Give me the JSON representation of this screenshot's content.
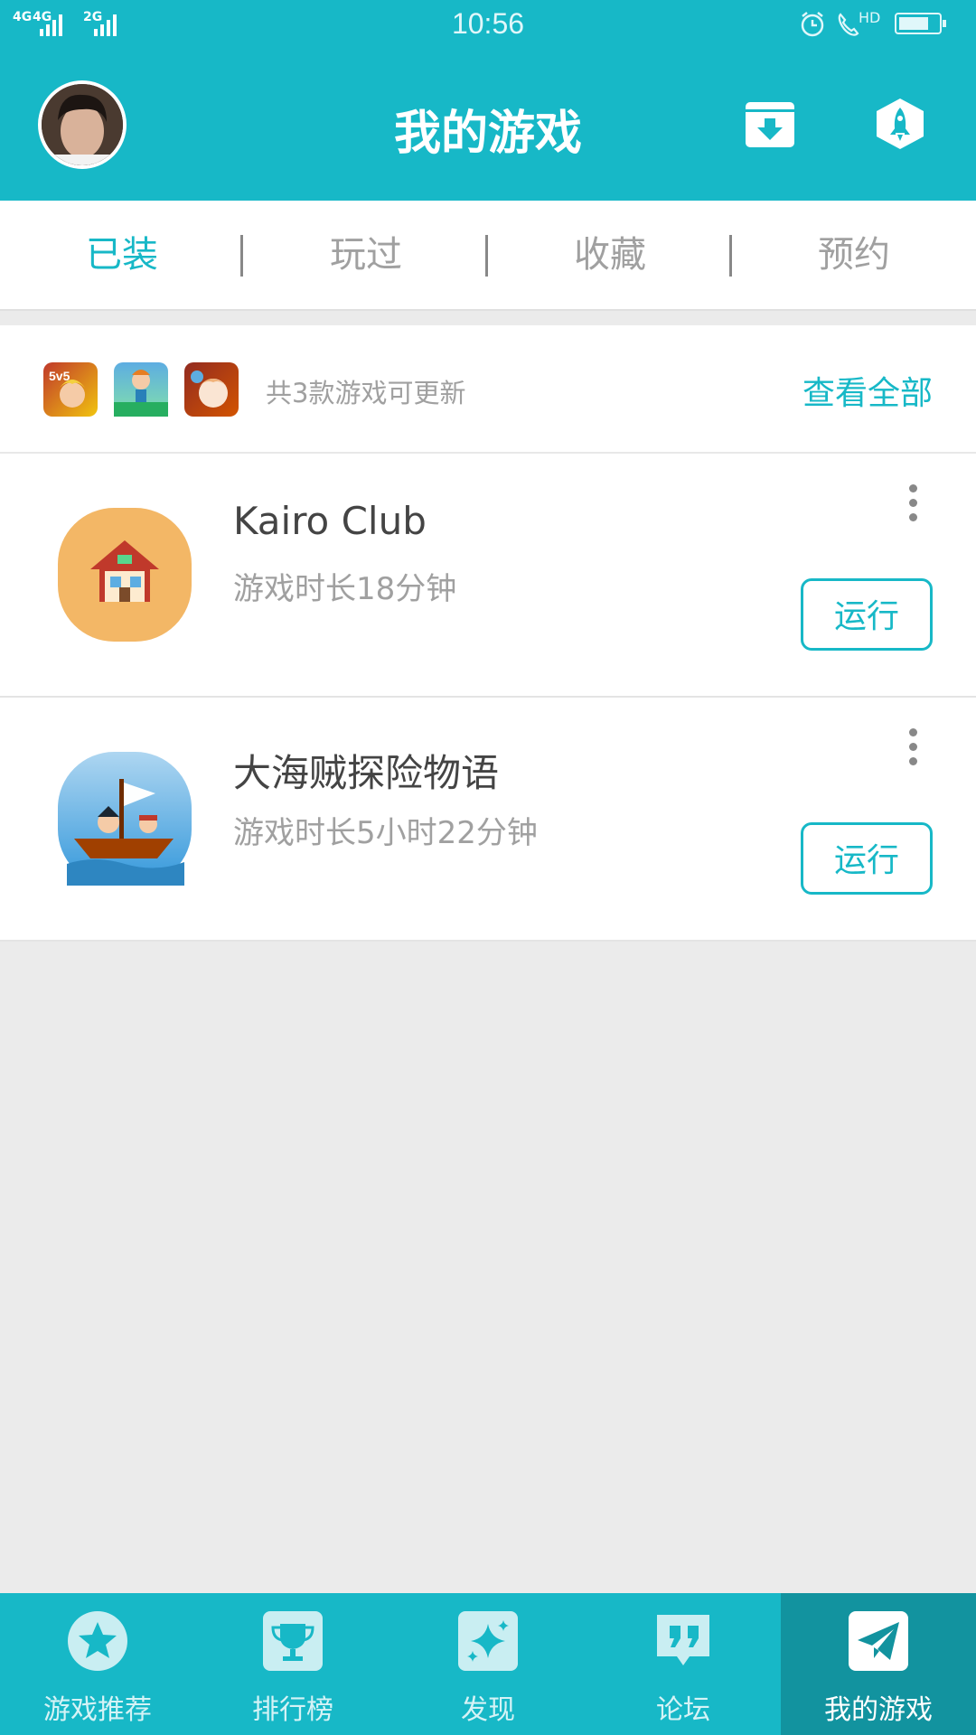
{
  "status_bar": {
    "time": "10:56",
    "network_1": "4G",
    "network_2": "4G",
    "network_3": "2G",
    "network_right": "HD"
  },
  "header": {
    "title": "我的游戏",
    "avatar_icon": "user-avatar",
    "download_icon": "download-box-icon",
    "rocket_icon": "rocket-icon"
  },
  "tabs": [
    {
      "label": "已装",
      "active": true
    },
    {
      "label": "玩过",
      "active": false
    },
    {
      "label": "收藏",
      "active": false
    },
    {
      "label": "预约",
      "active": false
    }
  ],
  "updates": {
    "text": "共3款游戏可更新",
    "view_all_label": "查看全部",
    "icons": [
      "honor-of-kings-icon",
      "runner-game-icon",
      "warrior-girl-icon"
    ]
  },
  "games": [
    {
      "name": "Kairo Club",
      "play_time": "游戏时长18分钟",
      "action_label": "运行",
      "icon": "house-icon"
    },
    {
      "name": "大海贼探险物语",
      "play_time": "游戏时长5小时22分钟",
      "action_label": "运行",
      "icon": "pirate-ship-icon"
    }
  ],
  "bottom_nav": [
    {
      "label": "游戏推荐",
      "icon": "star-icon",
      "active": false
    },
    {
      "label": "排行榜",
      "icon": "trophy-icon",
      "active": false
    },
    {
      "label": "发现",
      "icon": "sparkle-icon",
      "active": false
    },
    {
      "label": "论坛",
      "icon": "quote-bubble-icon",
      "active": false
    },
    {
      "label": "我的游戏",
      "icon": "paper-plane-icon",
      "active": true
    }
  ],
  "colors": {
    "primary": "#17b8c7",
    "primary_dark": "#12939f",
    "background": "#ebebeb",
    "text_dark": "#444444",
    "text_muted": "#a0a0a0"
  }
}
